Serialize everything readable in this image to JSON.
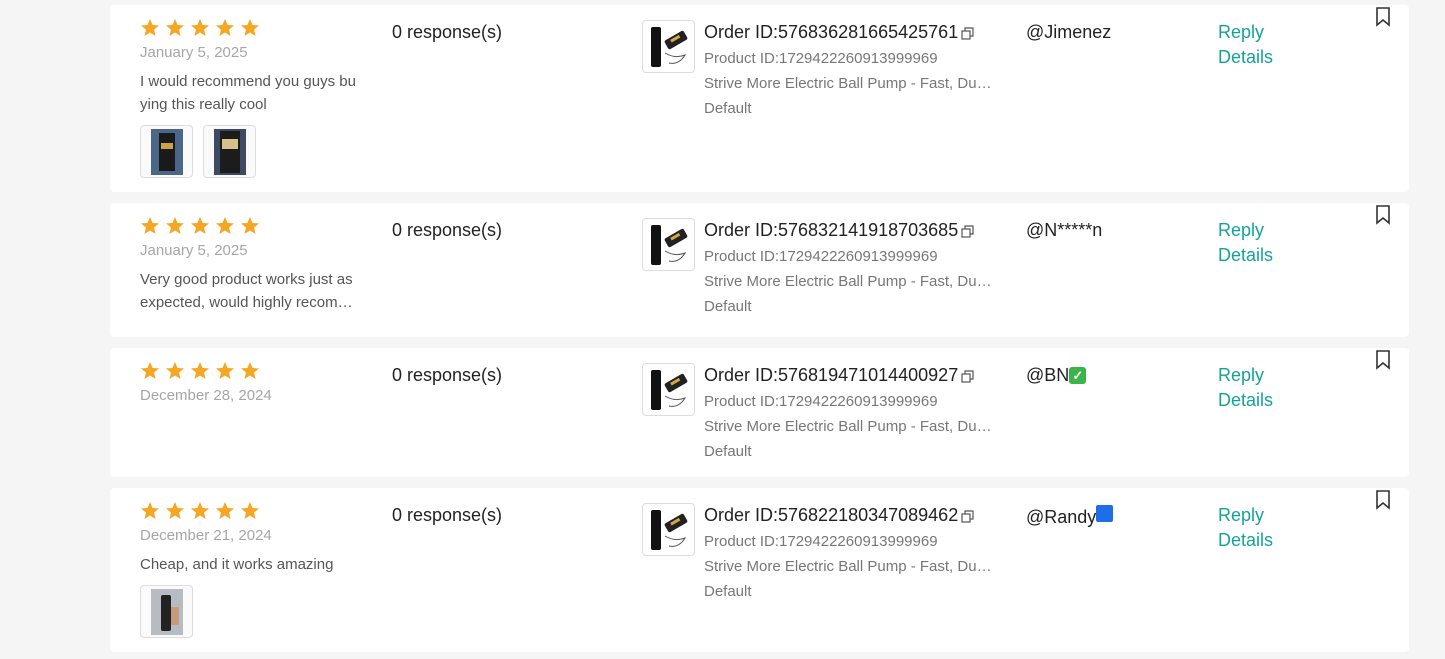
{
  "reviews": [
    {
      "rating": 5,
      "date": "January 5, 2025",
      "text": "I would recommend you guys buying this really cool",
      "responses": "0 response(s)",
      "order_id": "Order ID:576836281665425761",
      "product_id": "Product ID:1729422260913999969",
      "product_name": "Strive More Electric Ball Pump - Fast, Durable",
      "variant": "Default",
      "user": "@Jimenez",
      "reply_label": "Reply",
      "details_label": "Details",
      "photo_count": 2
    },
    {
      "rating": 5,
      "date": "January 5, 2025",
      "text": "Very good product works just as expected, would highly recommend",
      "responses": "0 response(s)",
      "order_id": "Order ID:576832141918703685",
      "product_id": "Product ID:1729422260913999969",
      "product_name": "Strive More Electric Ball Pump - Fast, Durable",
      "variant": "Default",
      "user": "@N*****n",
      "reply_label": "Reply",
      "details_label": "Details",
      "photo_count": 0
    },
    {
      "rating": 5,
      "date": "December 28, 2024",
      "text": "",
      "responses": "0 response(s)",
      "order_id": "Order ID:576819471014400927",
      "product_id": "Product ID:1729422260913999969",
      "product_name": "Strive More Electric Ball Pump - Fast, Durable",
      "variant": "Default",
      "user": "@BN",
      "user_emoji": "check-mark-emoji",
      "reply_label": "Reply",
      "details_label": "Details",
      "photo_count": 0
    },
    {
      "rating": 5,
      "date": "December 21, 2024",
      "text": "Cheap, and it works amazing",
      "responses": "0 response(s)",
      "order_id": "Order ID:576822180347089462",
      "product_id": "Product ID:1729422260913999969",
      "product_name": "Strive More Electric Ball Pump - Fast, Durable",
      "variant": "Default",
      "user": "@Randy",
      "user_emoji": "blue-square-emoji",
      "reply_label": "Reply",
      "details_label": "Details",
      "photo_count": 1
    }
  ],
  "colors": {
    "star": "#f5a623",
    "link": "#14a39a",
    "background": "#f5f5f5"
  }
}
